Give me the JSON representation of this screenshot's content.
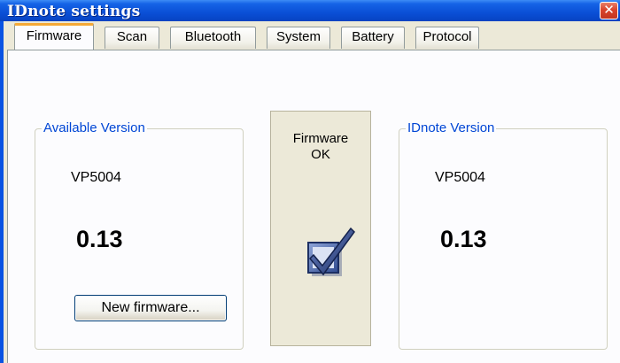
{
  "window": {
    "title": "IDnote settings",
    "close_glyph": "✕"
  },
  "tabs": [
    "Firmware",
    "Scan",
    "Bluetooth",
    "System",
    "Battery",
    "Protocol"
  ],
  "active_tab": "Firmware",
  "available": {
    "label": "Available Version",
    "model": "VP5004",
    "version": "0.13",
    "button": "New firmware..."
  },
  "status": {
    "text": "Firmware\nOK",
    "icon": "checkbox-checked-icon"
  },
  "device": {
    "label": "IDnote Version",
    "model": "VP5004",
    "version": "0.13"
  },
  "colors": {
    "titlebar": "#0a53e3",
    "group_label": "#0046d5",
    "active_tab_accent": "#f5a936"
  }
}
